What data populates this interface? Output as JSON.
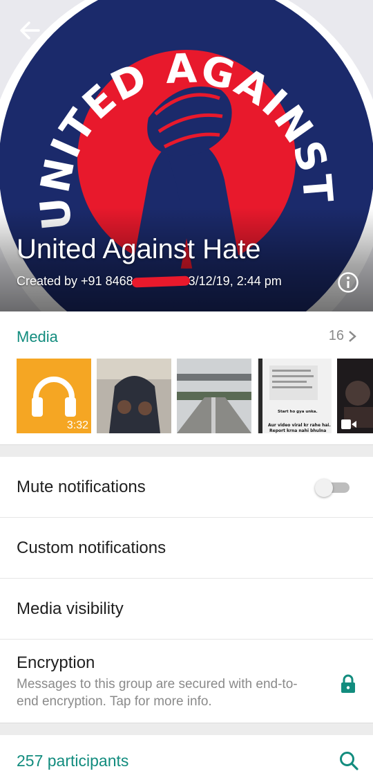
{
  "header": {
    "logo_text": "UNITED AGAINST HATE",
    "group_name": "United Against Hate",
    "created_prefix": "Created by +91 8468",
    "created_suffix": "3/12/19, 2:44 pm"
  },
  "media": {
    "label": "Media",
    "count": "16",
    "audio_duration": "3:32",
    "doc_snippet_1": "Start ho gya unka.",
    "doc_snippet_2": "Aur video viral kr rahe hai.",
    "doc_snippet_3": "Report krna nahi bhulna"
  },
  "settings": {
    "mute_label": "Mute notifications",
    "custom_label": "Custom notifications",
    "visibility_label": "Media visibility",
    "encryption_title": "Encryption",
    "encryption_desc": "Messages to this group are secured with end-to-end encryption. Tap for more info."
  },
  "participants": {
    "label": "257 participants"
  },
  "colors": {
    "accent": "#128c7e",
    "lock": "#128c7e",
    "logo_navy": "#1b2a6b",
    "logo_red": "#e8192c"
  }
}
